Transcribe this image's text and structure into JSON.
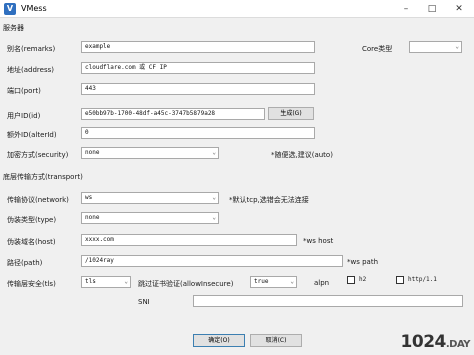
{
  "window": {
    "title": "VMess",
    "icon_letter": "V"
  },
  "server": {
    "section": "服务器",
    "remarks_label": "别名(remarks)",
    "remarks_value": "example",
    "core_label": "Core类型",
    "address_label": "地址(address)",
    "address_value": "cloudflare.com 或 CF IP",
    "port_label": "端口(port)",
    "port_value": "443",
    "id_label": "用户ID(id)",
    "id_value": "e50bb97b-1700-48df-a45c-3747b5879a28",
    "generate_label": "生成(G)",
    "alterid_label": "额外ID(alterId)",
    "alterid_value": "0",
    "security_label": "加密方式(security)",
    "security_value": "none",
    "security_hint": "*随便选,建议(auto)"
  },
  "transport": {
    "section": "底层传输方式(transport)",
    "network_label": "传输协议(network)",
    "network_value": "ws",
    "network_hint": "*默认tcp,选错会无法连接",
    "type_label": "伪装类型(type)",
    "type_value": "none",
    "host_label": "伪装域名(host)",
    "host_value": "xxxx.com",
    "host_hint": "*ws host",
    "path_label": "路径(path)",
    "path_value": "/1024ray",
    "path_hint": "*ws path",
    "tls_label": "传输层安全(tls)",
    "tls_value": "tls",
    "insecure_label": "跳过证书验证(allowInsecure)",
    "insecure_value": "true",
    "alpn_label": "alpn",
    "alpn_h2": "h2",
    "alpn_http": "http/1.1",
    "sni_label": "SNI",
    "sni_value": ""
  },
  "footer": {
    "ok": "确定(O)",
    "cancel": "取消(C)"
  },
  "watermark": {
    "main": "1024",
    "suffix": ".DAY"
  },
  "icons": {
    "minimize": "–",
    "maximize": "□",
    "close": "✕",
    "dropdown": "⌄"
  }
}
